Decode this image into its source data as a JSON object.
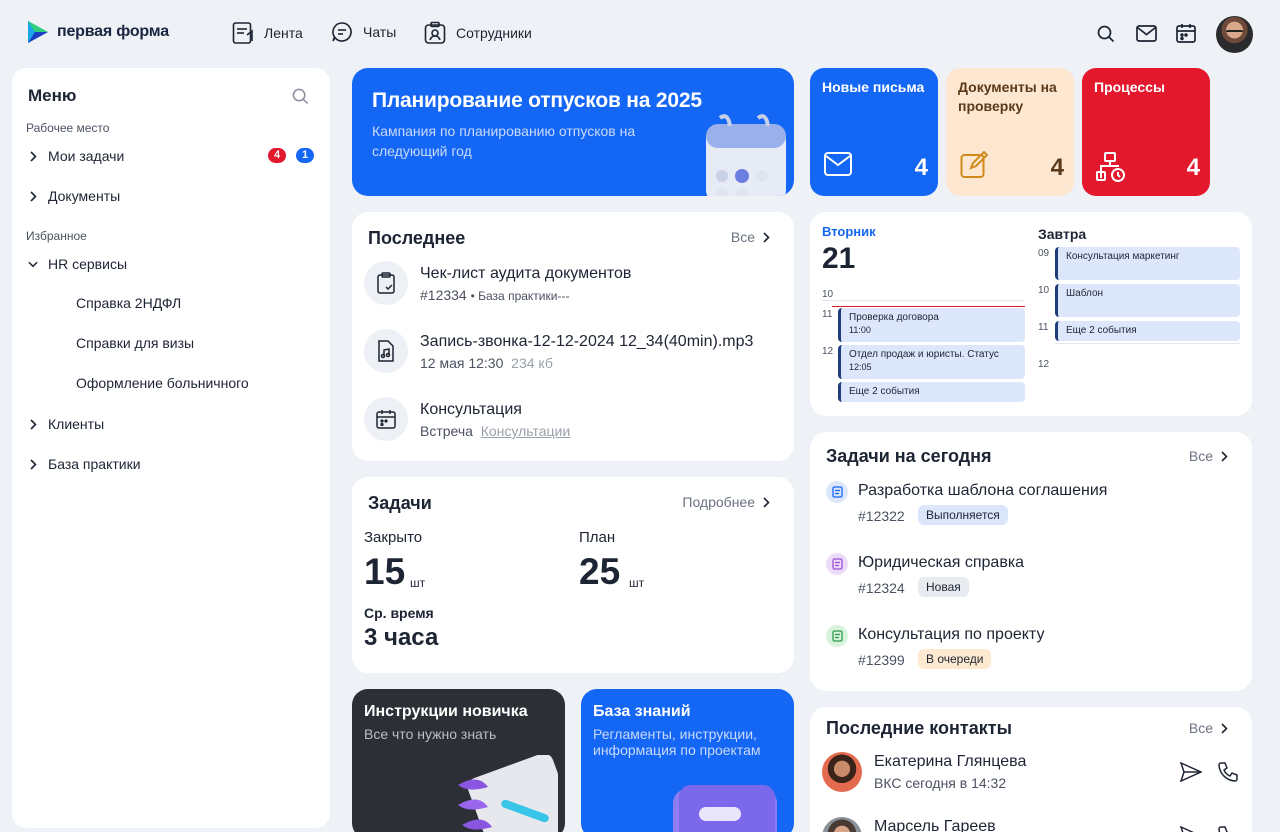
{
  "app": {
    "logo_text": "первая форма"
  },
  "nav": [
    {
      "label": "Лента",
      "icon": "feed-icon"
    },
    {
      "label": "Чаты",
      "icon": "chat-icon"
    },
    {
      "label": "Сотрудники",
      "icon": "employees-icon"
    }
  ],
  "header_icons": [
    "search-icon",
    "mail-icon",
    "calendar-icon"
  ],
  "sidebar": {
    "title": "Меню",
    "sections": {
      "workplace": "Рабочее место",
      "favorites": "Избранное"
    },
    "items": {
      "my_tasks": {
        "label": "Мои задачи",
        "badge_red": "4",
        "badge_blue": "1"
      },
      "documents": {
        "label": "Документы"
      },
      "hr": {
        "label": "HR сервисы"
      },
      "hr_sub": [
        "Справка 2НДФЛ",
        "Справки для визы",
        "Оформление больничного"
      ],
      "clients": {
        "label": "Клиенты"
      },
      "practice": {
        "label": "База практики"
      }
    }
  },
  "banner": {
    "title": "Планирование отпусков на 2025",
    "subtitle": "Кампания по планированию отпусков на следующий год"
  },
  "tiles": [
    {
      "label": "Новые письма",
      "count": "4",
      "icon": "mail-icon",
      "color": "#1466f5"
    },
    {
      "label": "Документы на проверку",
      "count": "4",
      "icon": "edit-icon",
      "color": "#fde7d0"
    },
    {
      "label": "Процессы",
      "count": "4",
      "icon": "process-icon",
      "color": "#e3182d"
    }
  ],
  "recent": {
    "title": "Последнее",
    "all_label": "Все",
    "items": [
      {
        "title": "Чек-лист аудита документов",
        "meta1": "#12334",
        "meta2": "• База практики---",
        "icon": "clipboard-icon"
      },
      {
        "title": "Запись-звонка-12-12-2024 12_34(40min).mp3",
        "meta1": "12 мая 12:30",
        "meta2": "234 кб",
        "icon": "audio-file-icon"
      },
      {
        "title": "Консультация",
        "meta1": "Встреча",
        "meta2": "Консультации",
        "icon": "calendar-icon"
      }
    ]
  },
  "tasks_stats": {
    "title": "Задачи",
    "more_label": "Подробнее",
    "closed_label": "Закрыто",
    "closed_value": "15",
    "plan_label": "План",
    "plan_value": "25",
    "unit": "шт",
    "avg_label": "Ср. время",
    "avg_value": "3 часа"
  },
  "calendar": {
    "today": {
      "weekday": "Вторник",
      "day": "21",
      "hours": [
        "10",
        "11",
        "12"
      ],
      "events": [
        {
          "title": "Проверка договора",
          "time": "11:00"
        },
        {
          "title": "Отдел продаж и юристы. Статус",
          "time": "12:05"
        },
        {
          "title": "Еще 2 события",
          "time": ""
        }
      ]
    },
    "tomorrow": {
      "label": "Завтра",
      "hours": [
        "09",
        "10",
        "11",
        "12"
      ],
      "events": [
        {
          "title": "Консультация маркетинг"
        },
        {
          "title": "Шаблон"
        },
        {
          "title": "Еще 2 события"
        }
      ]
    }
  },
  "today_tasks": {
    "title": "Задачи на сегодня",
    "all_label": "Все",
    "items": [
      {
        "title": "Разработка шаблона соглашения",
        "num": "#12322",
        "status": "Выполняется",
        "status_color": "#dbe6fb",
        "icon_color": "#dbe6fb"
      },
      {
        "title": "Юридическая справка",
        "num": "#12324",
        "status": "Новая",
        "status_color": "#e8ebf0",
        "icon_color": "#ecdcf7"
      },
      {
        "title": "Консультация по проекту",
        "num": "#12399",
        "status": "В очереди",
        "status_color": "#fde9cf",
        "icon_color": "#d8f2dc"
      }
    ]
  },
  "bottom_tiles": [
    {
      "title": "Инструкции новичка",
      "subtitle": "Все что нужно знать",
      "color": "#2c2f36"
    },
    {
      "title": "База знаний",
      "subtitle": "Регламенты, инструкции, информация по проектам",
      "color": "#1466f5"
    }
  ],
  "contacts": {
    "title": "Последние контакты",
    "all_label": "Все",
    "items": [
      {
        "name": "Екатерина Глянцева",
        "sub": "ВКС сегодня в 14:32"
      },
      {
        "name": "Марсель Гареев",
        "sub": ""
      }
    ]
  }
}
